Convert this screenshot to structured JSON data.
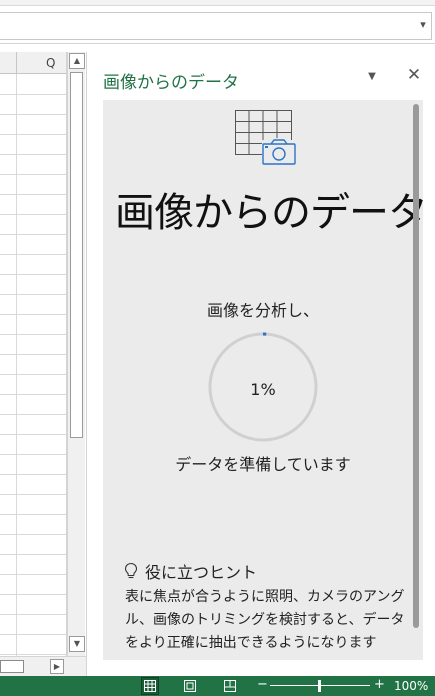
{
  "grid": {
    "visible_column": "Q"
  },
  "pane": {
    "title": "画像からのデータ",
    "heading": "画像からのデータ",
    "analyzing_text": "画像を分析し、",
    "progress_value": 0.01,
    "progress_label": "1%",
    "preparing_text": "データを準備しています",
    "hint_title": "役に立つヒント",
    "hint_body": "表に焦点が合うように照明、カメラのアングル、画像のトリミングを検討すると、データをより正確に抽出できるようになります"
  },
  "icons": {
    "dropdown": "chevron-down-icon",
    "close": "close-icon",
    "illustration": "table-camera-icon",
    "hint": "lightbulb-icon",
    "views": [
      "normal-view-icon",
      "page-layout-view-icon",
      "page-break-preview-icon"
    ]
  },
  "statusbar": {
    "zoom_minus": "−",
    "zoom_plus": "+",
    "zoom_level": "100%"
  },
  "colors": {
    "accent": "#217346",
    "pane_card": "#ebebeb",
    "progress_ring": "#d0d0d0",
    "progress_fill": "#2b74c7"
  }
}
